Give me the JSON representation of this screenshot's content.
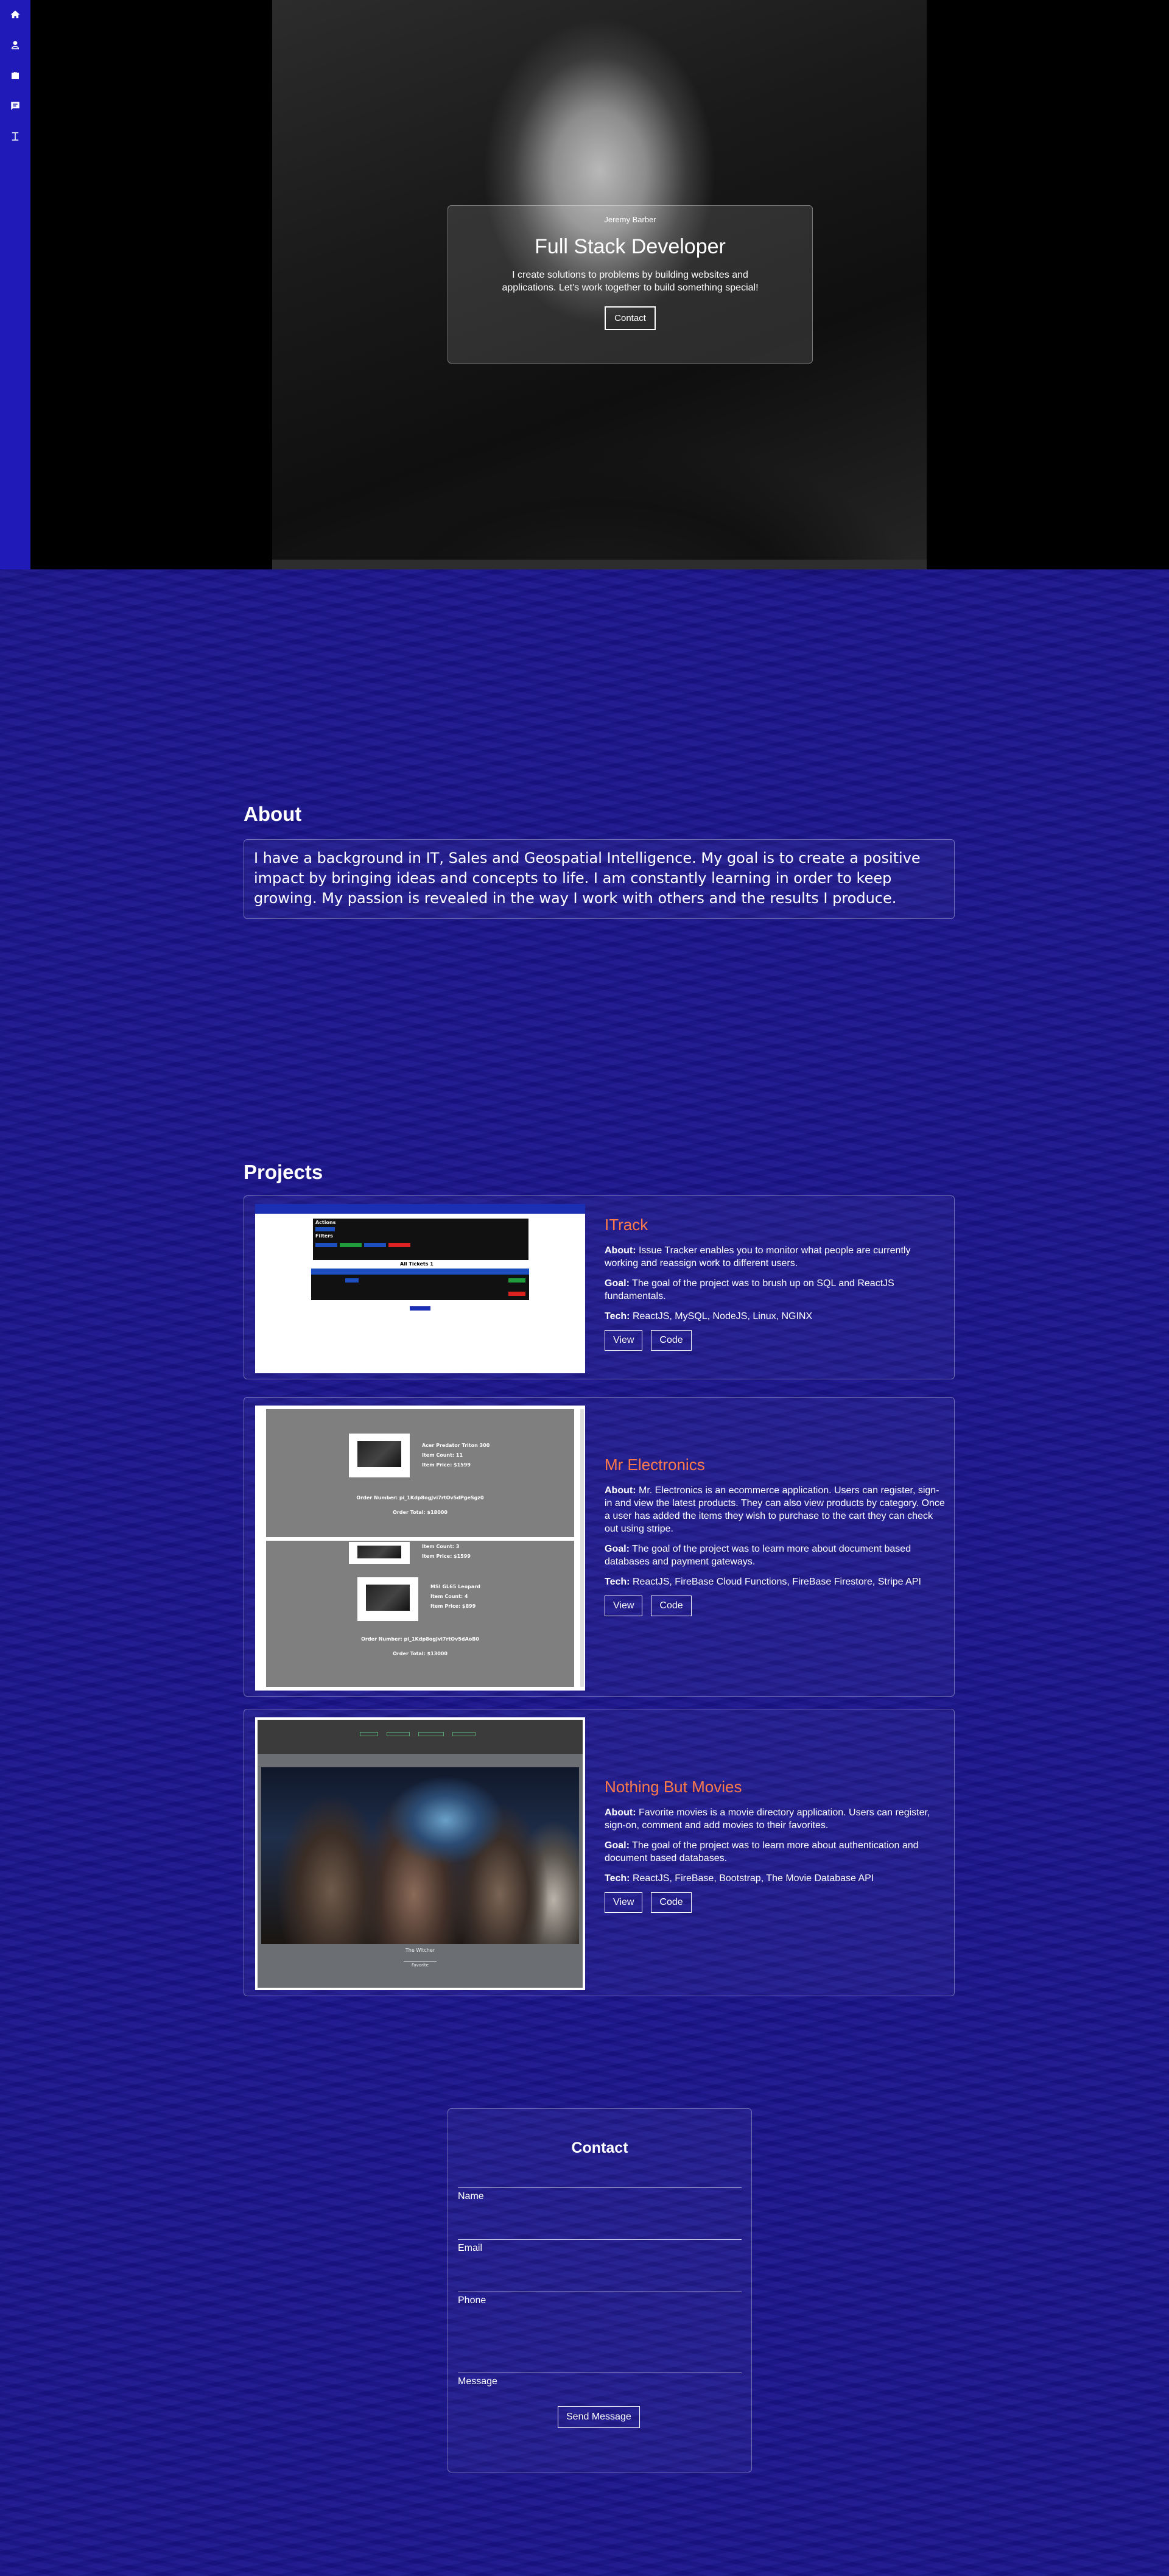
{
  "sidebar": {
    "items": [
      {
        "icon": "home-icon"
      },
      {
        "icon": "user-icon"
      },
      {
        "icon": "briefcase-icon"
      },
      {
        "icon": "message-icon"
      },
      {
        "icon": "text-cursor-icon"
      }
    ]
  },
  "hero": {
    "name": "Jeremy Barber",
    "title": "Full Stack Developer",
    "text": "I create solutions to problems by building websites and applications. Let's work together to build something special!",
    "button": "Contact"
  },
  "about": {
    "title": "About",
    "text": "I have a background in IT, Sales and Geospatial Intelligence. My goal is to create a positive impact by bringing ideas and concepts to life. I am constantly learning in order to keep growing. My passion is revealed in the way I work with others and the results I produce."
  },
  "projects": {
    "title": "Projects",
    "about_label": "About:",
    "goal_label": "Goal:",
    "tech_label": "Tech:",
    "view_label": "View",
    "code_label": "Code",
    "items": [
      {
        "name": "ITrack",
        "about": "Issue Tracker enables you to monitor what people are currently working and reassign work to different users.",
        "goal": "The goal of the project was to brush up on SQL and ReactJS fundamentals.",
        "tech": "ReactJS, MySQL, NodeJS, Linux, NGINX",
        "screenshot": {
          "panel_title_1": "Actions",
          "panel_title_2": "Filters",
          "tickets_label": "All Tickets 1"
        }
      },
      {
        "name": "Mr Electronics",
        "about": "Mr. Electronics is an ecommerce application. Users can register, sign-in and view the latest products. They can also view products by category. Once a user has added the items they wish to purchase to the cart they can check out using stripe.",
        "goal": "The goal of the project was to learn more about document based databases and payment gateways.",
        "tech": "ReactJS, FireBase Cloud Functions, FireBase Firestore, Stripe API",
        "screenshot": {
          "item_1": "Acer Predator Triton 300",
          "item_1_count": "Item Count: 11",
          "item_1_price": "Item Price: $1599",
          "order_1": "Order Number: pi_1Kdp8ogJvi7rtOv5dPgeSgz0",
          "order_1_total": "Order Total: $18000",
          "item_2_count": "Item Count: 3",
          "item_2_price": "Item Price: $1599",
          "item_3": "MSI GL65 Leopard",
          "item_3_count": "Item Count: 4",
          "item_3_price": "Item Price: $899",
          "order_2": "Order Number: pi_1Kdp8ogJvi7rtOv5dAoB0",
          "order_2_total": "Order Total: $13000"
        }
      },
      {
        "name": "Nothing But Movies",
        "about": "Favorite movies is a movie directory application. Users can register, sign-on, comment and add movies to their favorites.",
        "goal": "The goal of the project was to learn more about authentication and document based databases.",
        "tech": "ReactJS, FireBase, Bootstrap, The Movie Database API",
        "screenshot": {
          "caption": "The Witcher",
          "button": "Favorite"
        }
      }
    ]
  },
  "contact": {
    "title": "Contact",
    "name_label": "Name",
    "email_label": "Email",
    "phone_label": "Phone",
    "message_label": "Message",
    "button": "Send Message"
  }
}
